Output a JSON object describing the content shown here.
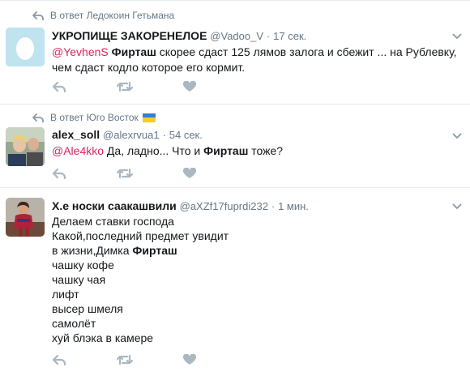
{
  "tweets": [
    {
      "reply_context": "В ответ Ледокоин Гетьмана",
      "name": "УКРОПИЩЕ ЗАКОРЕНЕЛОЕ",
      "handle": "@Vadoo_V",
      "dot": "·",
      "time": "17 сек.",
      "mention": "@YevhenS",
      "keyword": "Фирташ",
      "line1_rest": " скорее сдаст 125 лямов залога и сбежит ... на Рублевку,",
      "line2": "чем сдаст кодло которое его кормит."
    },
    {
      "reply_context": "В ответ Юго Восток",
      "name": "alex_soll",
      "handle": "@alexrvua1",
      "dot": "·",
      "time": "54 сек.",
      "mention": "@Ale4kko",
      "text_mid": " Да, ладно... Что и ",
      "keyword": "Фирташ",
      "text_end": " тоже?"
    },
    {
      "name": "Х.е носки саакашвили",
      "handle": "@aXZf17fuprdi232",
      "dot": "·",
      "time": "1 мин.",
      "lines": [
        "Делаем ставки господа",
        "Какой,последний предмет увидит",
        "в жизни,Димка ",
        "чашку кофе",
        "чашку чая",
        "лифт",
        "высер шмеля",
        "самолёт",
        "хуй блэка в камере"
      ],
      "keyword": "Фирташ"
    }
  ],
  "icons": [
    "reply-icon",
    "retweet-icon",
    "like-icon",
    "chevron-down-icon",
    "reply-context-icon"
  ],
  "colors": {
    "mention": "#e0245e",
    "muted": "#657786",
    "icon": "#aab8c2",
    "divider": "#e6ecf0"
  }
}
